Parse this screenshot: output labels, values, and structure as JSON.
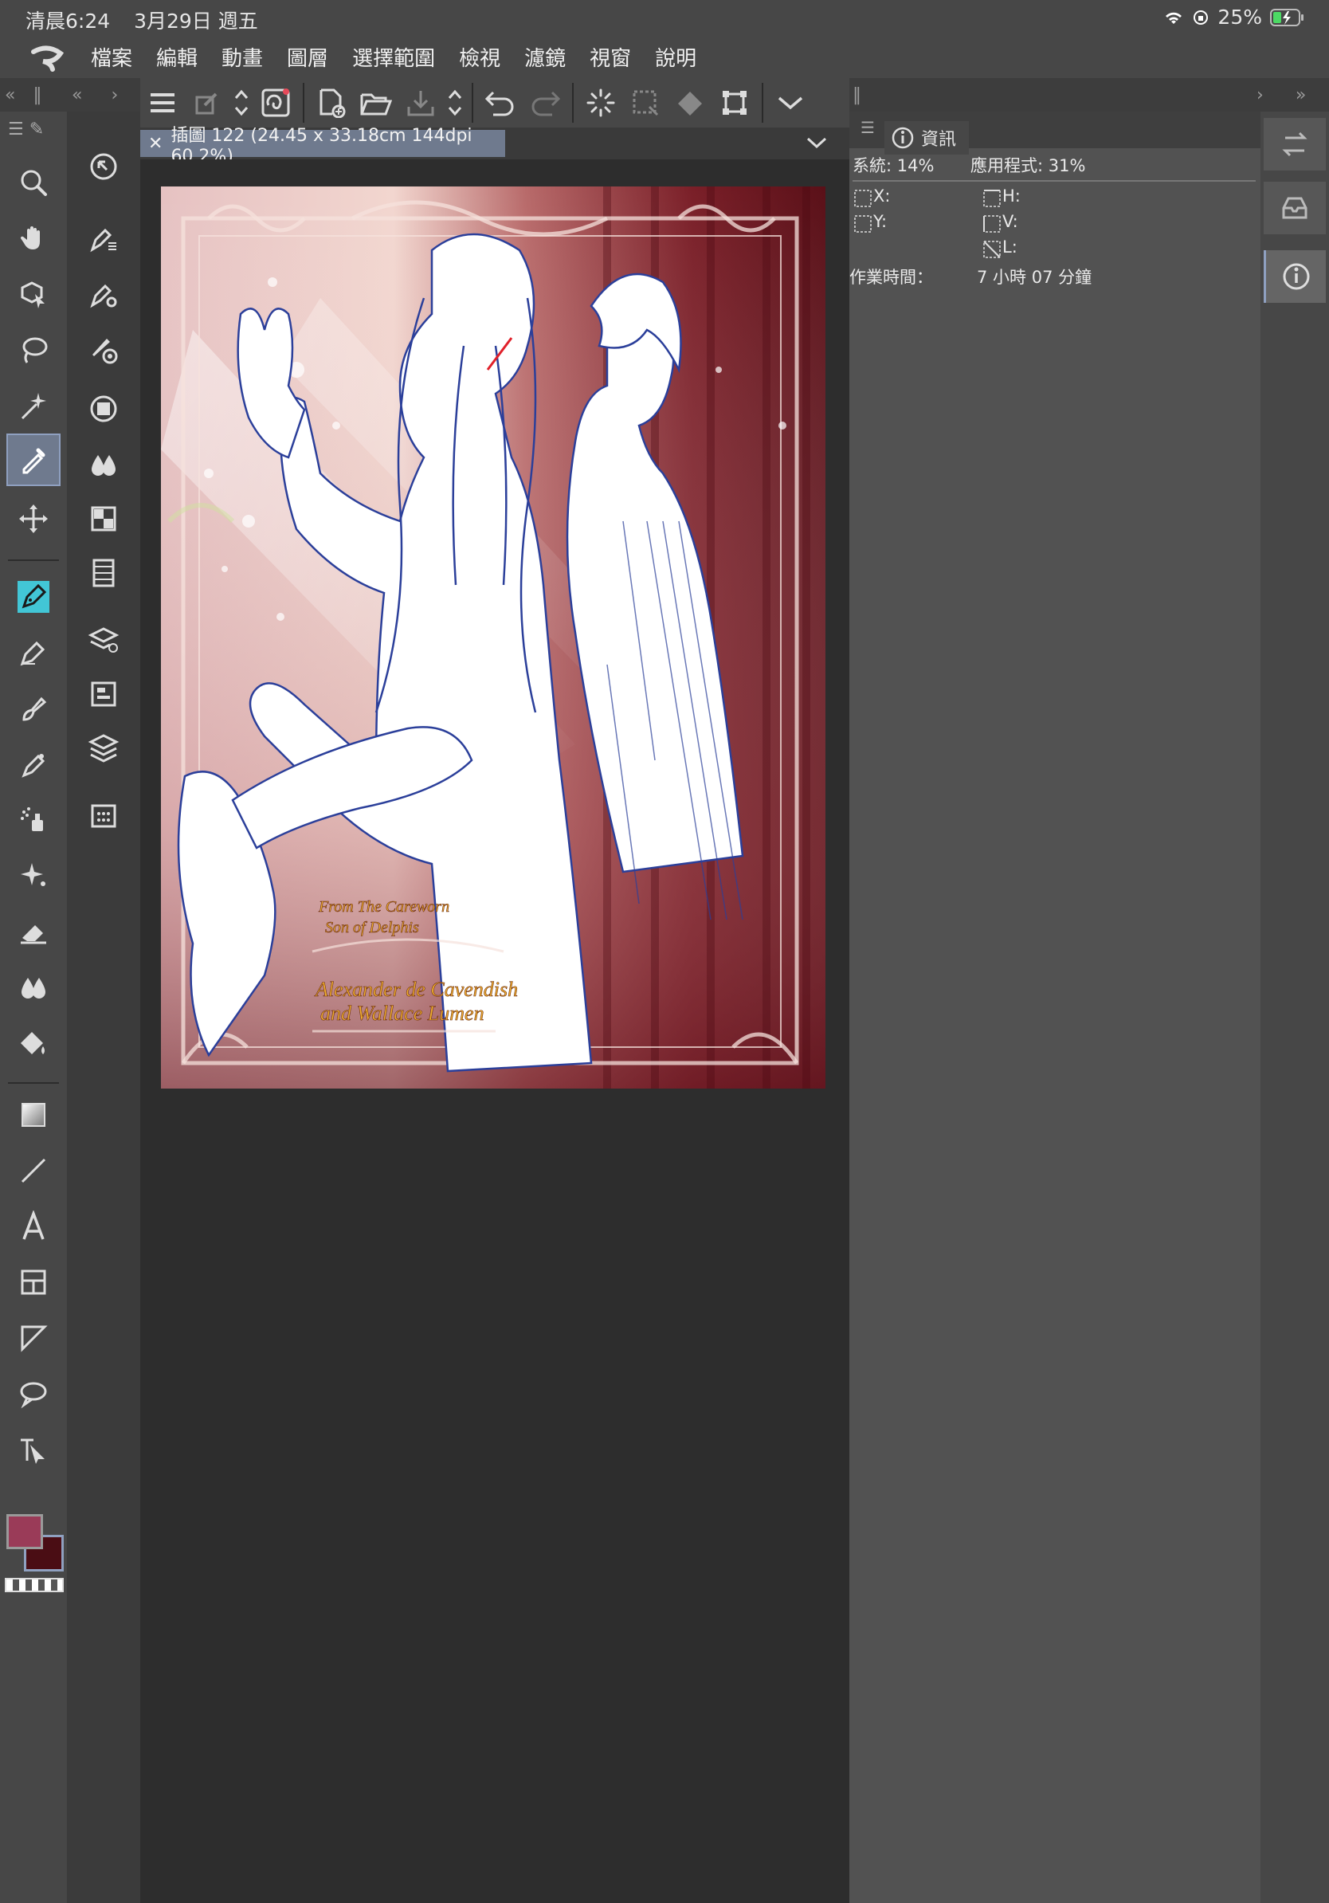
{
  "status": {
    "time": "清晨6:24",
    "date": "3月29日 週五",
    "battery": "25%"
  },
  "menu": [
    "檔案",
    "編輯",
    "動畫",
    "圖層",
    "選擇範圍",
    "檢視",
    "濾鏡",
    "視窗",
    "說明"
  ],
  "document": {
    "tab_title": "插圖 122 (24.45 x 33.18cm 144dpi 60.2%)"
  },
  "artwork_text": {
    "line1": "From The Careworn",
    "line2": "Son of Delphis",
    "line3": "Alexander de Cavendish",
    "line4": "and Wallace Lumen"
  },
  "info_panel": {
    "tab_label": "資訊",
    "system": "系統: 14%",
    "application": "應用程式: 31%",
    "x_label": "X:",
    "y_label": "Y:",
    "h_label": "H:",
    "v_label": "V:",
    "l_label": "L:",
    "work_time_label": "作業時間：",
    "work_time_value": "7 小時 07 分鐘"
  },
  "colors": {
    "main": "#9a3b58",
    "sub": "#4a0d14",
    "active_tool": "#6f7a8e",
    "accent_cyan": "#42c6d6"
  }
}
